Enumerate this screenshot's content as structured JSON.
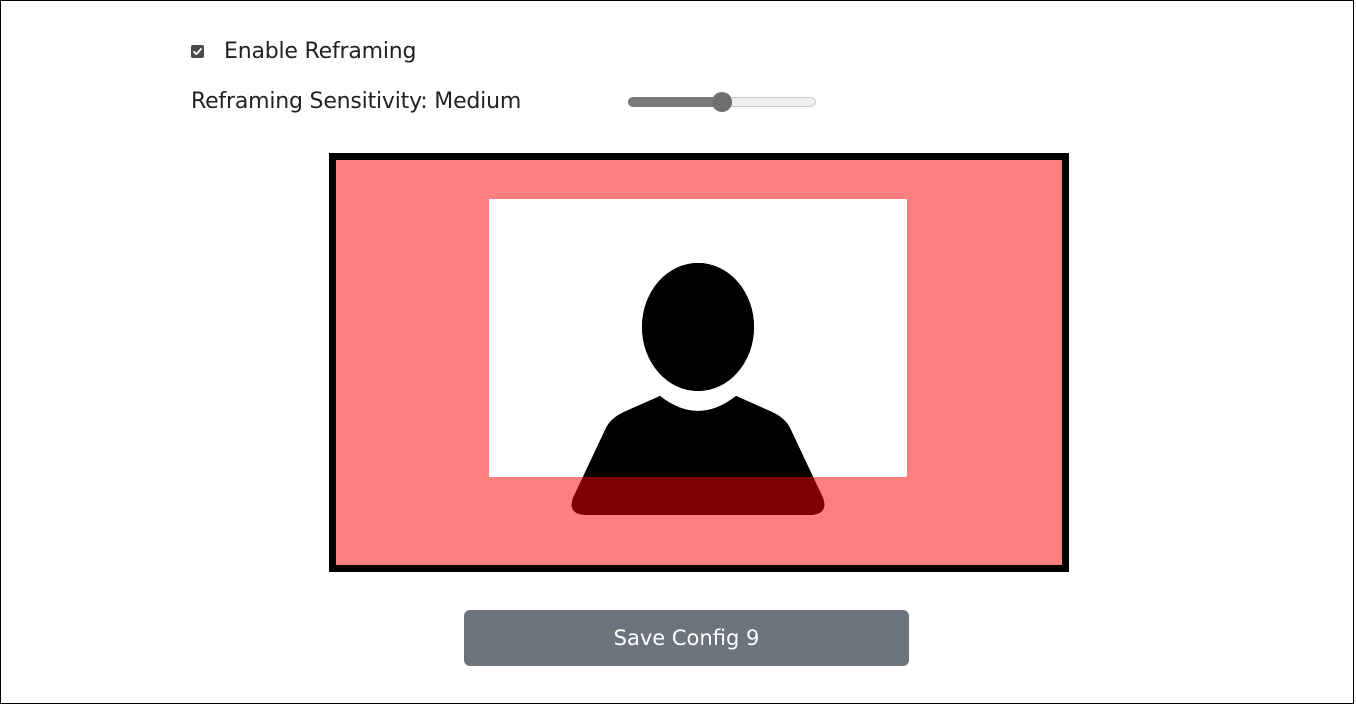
{
  "settings": {
    "enable_reframing": {
      "label": "Enable Reframing",
      "checked": true
    },
    "sensitivity": {
      "label": "Reframing Sensitivity: Medium",
      "value": 0.5
    }
  },
  "preview": {
    "frame_color": "#000000",
    "outside_color": "#ff7f7f",
    "safe_area_color": "#ffffff",
    "subject_icon": "person-silhouette-icon"
  },
  "actions": {
    "save_label": "Save Config 9"
  }
}
